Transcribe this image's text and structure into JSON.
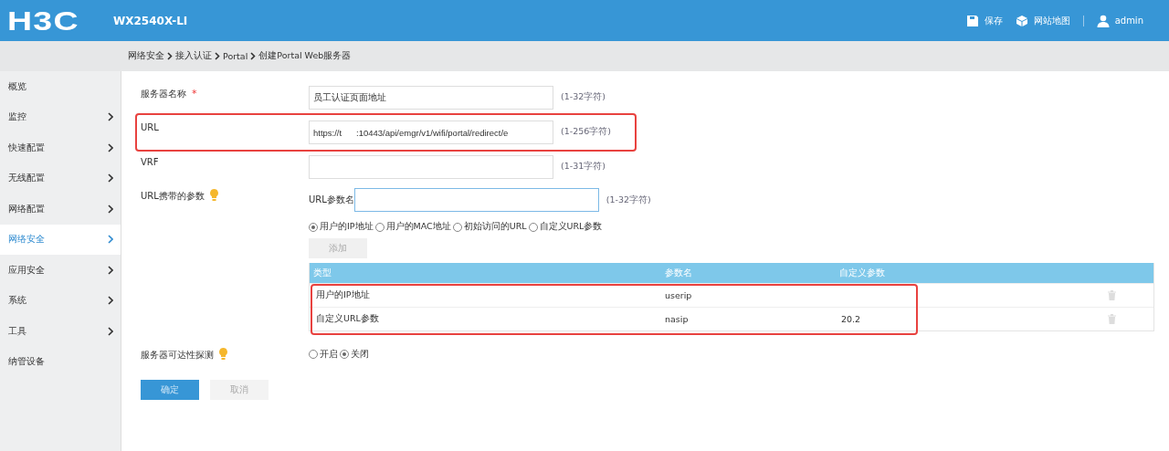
{
  "header": {
    "logo": "H3C",
    "model": "WX2540X-LI",
    "actions": [
      {
        "kind": "save",
        "label": "保存"
      },
      {
        "kind": "sitemap",
        "label": "网站地图"
      },
      {
        "kind": "user",
        "label": "admin"
      }
    ]
  },
  "breadcrumb": [
    "网络安全",
    "接入认证",
    "Portal",
    "创建Portal Web服务器"
  ],
  "sidebar": {
    "items": [
      {
        "label": "概览",
        "has_submenu": false,
        "selected": false
      },
      {
        "label": "监控",
        "has_submenu": true,
        "selected": false
      },
      {
        "label": "快速配置",
        "has_submenu": true,
        "selected": false
      },
      {
        "label": "无线配置",
        "has_submenu": true,
        "selected": false
      },
      {
        "label": "网络配置",
        "has_submenu": true,
        "selected": false
      },
      {
        "label": "网络安全",
        "has_submenu": true,
        "selected": true
      },
      {
        "label": "应用安全",
        "has_submenu": true,
        "selected": false
      },
      {
        "label": "系统",
        "has_submenu": true,
        "selected": false
      },
      {
        "label": "工具",
        "has_submenu": true,
        "selected": false
      },
      {
        "label": "纳管设备",
        "has_submenu": false,
        "selected": false
      }
    ]
  },
  "form": {
    "fields": [
      {
        "label": "服务器名称",
        "required_mark": "*",
        "value": "员工认证页面地址",
        "hint": "(1-32字符)",
        "highlighted": false
      },
      {
        "label": "URL",
        "value": "https://t      :10443/api/emgr/v1/wifi/portal/redirect/e",
        "hint": "(1-256字符)",
        "highlighted": true
      },
      {
        "label": "VRF",
        "hint": "(1-31字符)",
        "highlighted": false
      }
    ],
    "url_params": {
      "label": "URL携带的参数",
      "param_name_label": "URL参数名",
      "hint": "(1-32字符)",
      "types": [
        {
          "label": "用户的IP地址",
          "selected": true
        },
        {
          "label": "用户的MAC地址",
          "selected": false
        },
        {
          "label": "初始访问的URL",
          "selected": false
        },
        {
          "label": "自定义URL参数",
          "selected": false
        }
      ],
      "add_button": "添加",
      "table": {
        "columns": [
          "类型",
          "参数名",
          "自定义参数"
        ],
        "highlighted": true,
        "rows": [
          {
            "type": "用户的IP地址",
            "name": "userip",
            "custom": ""
          },
          {
            "type": "自定义URL参数",
            "name": "nasip",
            "custom": "20.2"
          }
        ]
      }
    },
    "reachability": {
      "label": "服务器可达性探测",
      "options": [
        {
          "label": "开启",
          "selected": false
        },
        {
          "label": "关闭",
          "selected": true
        }
      ]
    },
    "buttons": {
      "ok": "确定",
      "cancel": "取消"
    }
  }
}
